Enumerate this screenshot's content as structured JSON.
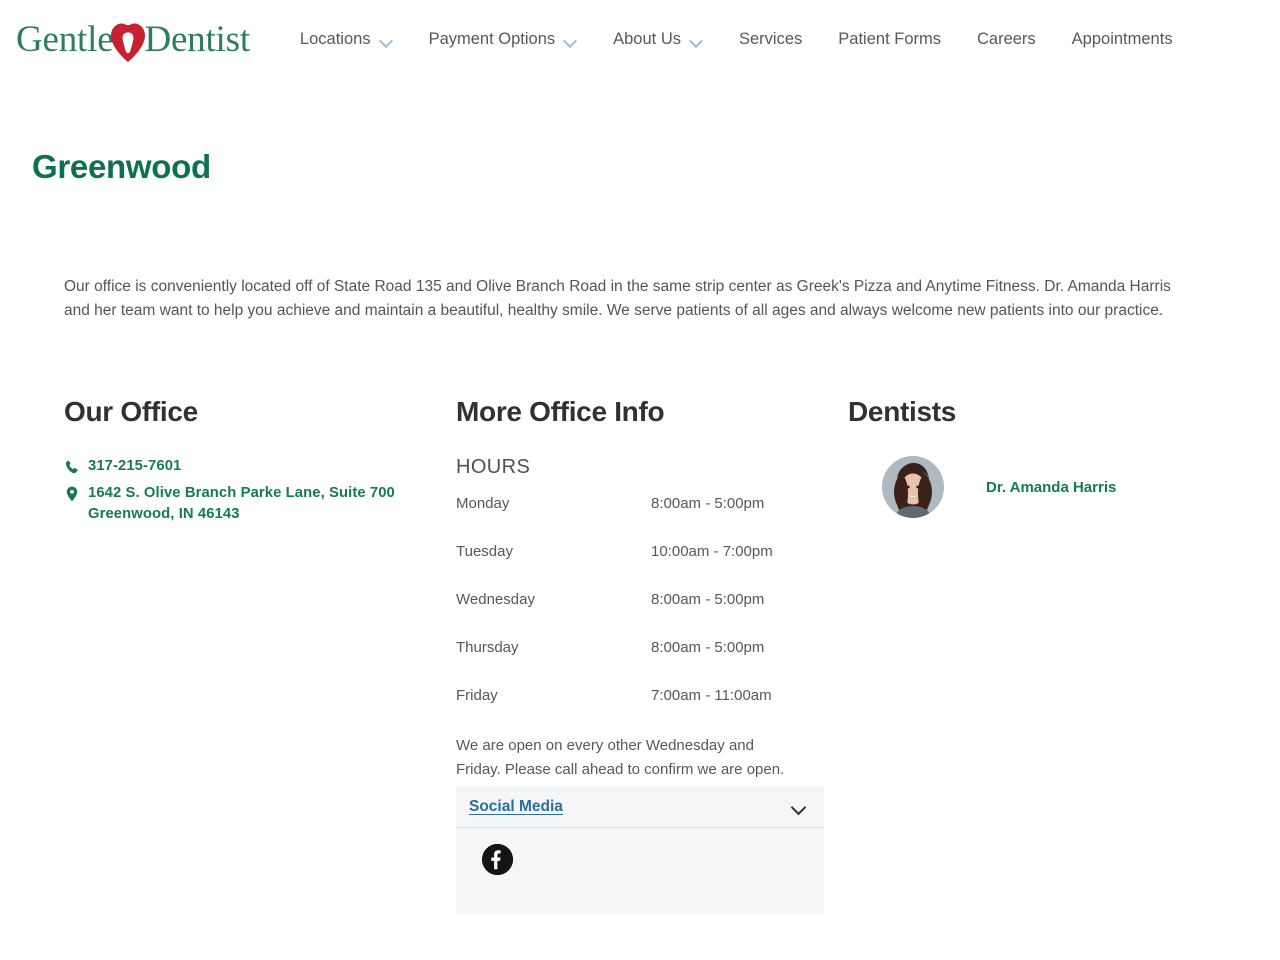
{
  "header": {
    "logo": {
      "word1": "Gentle",
      "word2": "Dentist",
      "mark": "heart-tooth-icon"
    },
    "nav": [
      {
        "label": "Locations",
        "has_dropdown": true
      },
      {
        "label": "Payment Options",
        "has_dropdown": true
      },
      {
        "label": "About Us",
        "has_dropdown": true
      },
      {
        "label": "Services",
        "has_dropdown": false
      },
      {
        "label": "Patient Forms",
        "has_dropdown": false
      },
      {
        "label": "Careers",
        "has_dropdown": false
      },
      {
        "label": "Appointments",
        "has_dropdown": false
      }
    ]
  },
  "page": {
    "title": "Greenwood",
    "intro": "Our office is conveniently located off of State Road 135 and Olive Branch Road in the same strip center as Greek's Pizza and Anytime Fitness. Dr. Amanda Harris and her team want to help you achieve and maintain a beautiful, healthy smile. We serve patients of all ages and always welcome new patients into our practice."
  },
  "office": {
    "heading": "Our Office",
    "phone": "317-215-7601",
    "address_line1": "1642 S. Olive Branch Parke Lane, Suite 700",
    "address_line2": "Greenwood, IN 46143"
  },
  "more_info": {
    "heading": "More Office Info",
    "hours_label": "HOURS",
    "hours": [
      {
        "day": "Monday",
        "time": "8:00am - 5:00pm"
      },
      {
        "day": "Tuesday",
        "time": "10:00am - 7:00pm"
      },
      {
        "day": "Wednesday",
        "time": "8:00am - 5:00pm"
      },
      {
        "day": "Thursday",
        "time": "8:00am - 5:00pm"
      },
      {
        "day": "Friday",
        "time": "7:00am - 11:00am"
      }
    ],
    "note": "We are open on every other Wednesday and Friday. Please call ahead to confirm we are open.",
    "social": {
      "label": "Social Media",
      "expanded": true,
      "networks": [
        "facebook"
      ]
    }
  },
  "dentists": {
    "heading": "Dentists",
    "list": [
      {
        "name": "Dr. Amanda Harris"
      }
    ]
  },
  "colors": {
    "brand_green": "#16795a",
    "title_green": "#0d7050",
    "logo_green": "#2e7d5e",
    "logo_red": "#c9202f",
    "link_blue": "#2b6ca3",
    "chevron_blue": "#9fbdd4",
    "heading_dark": "#2f3133",
    "panel_bg": "#f5f6f7"
  }
}
